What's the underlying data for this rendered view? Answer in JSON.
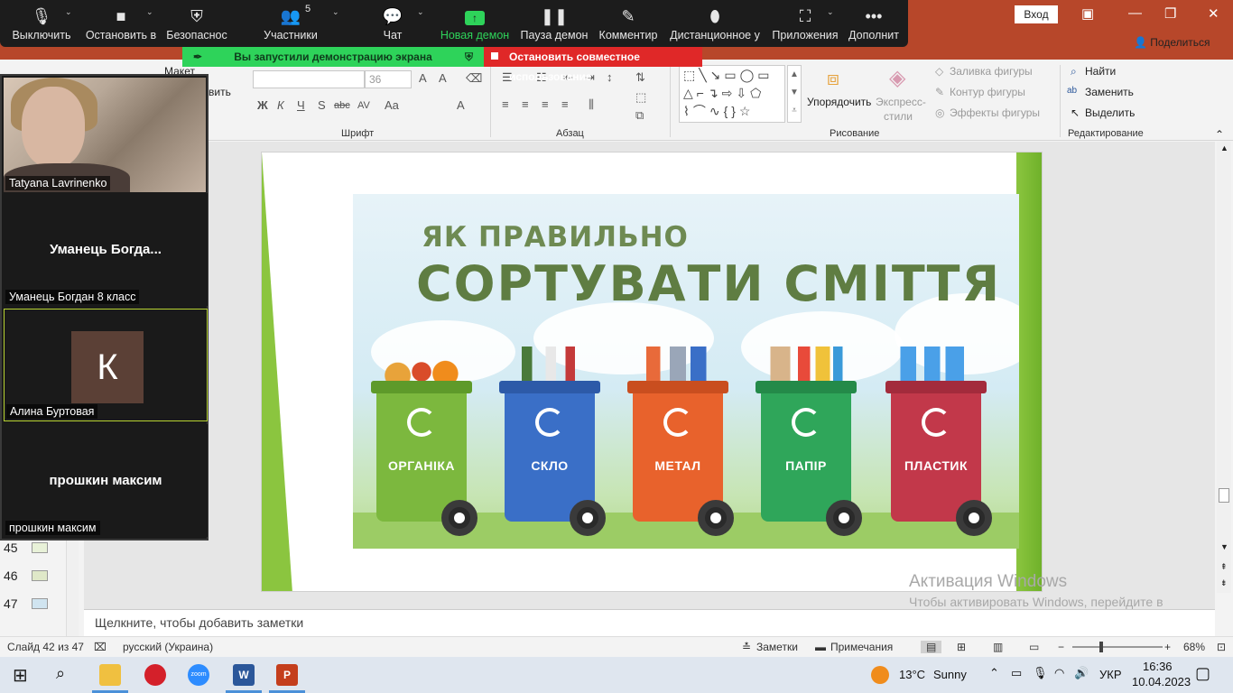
{
  "zoom_toolbar": {
    "items": [
      {
        "label": "Выключить",
        "icon": "microphone-icon"
      },
      {
        "label": "Остановить в",
        "icon": "video-camera-icon"
      },
      {
        "label": "Безопаснос",
        "icon": "shield-icon"
      },
      {
        "label": "Участники",
        "icon": "participants-icon"
      },
      {
        "label": "Чат",
        "icon": "chat-icon"
      },
      {
        "label": "Новая демон",
        "icon": "share-screen-icon"
      },
      {
        "label": "Пауза демон",
        "icon": "pause-icon"
      },
      {
        "label": "Комментир",
        "icon": "annotate-pen-icon"
      },
      {
        "label": "Дистанционное у",
        "icon": "remote-control-icon"
      },
      {
        "label": "Приложения",
        "icon": "apps-icon"
      },
      {
        "label": "Дополнит",
        "icon": "more-icon"
      }
    ],
    "participant_count": "5",
    "share_banner": "Вы запустили демонстрацию экрана",
    "stop_banner": "Остановить совместное использование",
    "accent_green": "#2ed35a",
    "accent_red": "#e02828"
  },
  "participants": [
    {
      "name": "Tatyana Lavrinenko",
      "display": ""
    },
    {
      "name": "Уманець Богдан 8 класс",
      "display": "Уманець  Богда..."
    },
    {
      "name": "Алина Буртовая",
      "display": "",
      "initial": "К"
    },
    {
      "name": "прошкин максим",
      "display": "прошкин максим"
    }
  ],
  "ppt": {
    "signin": "Вход",
    "share": "Поделиться",
    "ribbon": {
      "font_size": "36",
      "groups": [
        "Шрифт",
        "Абзац",
        "Рисование",
        "Редактирование"
      ],
      "partial_left_1": "Макет",
      "partial_left_2": "вить",
      "arrange": "Упорядочить",
      "quick_styles_1": "Экспресс-",
      "quick_styles_2": "стили",
      "shape_fill": "Заливка фигуры",
      "shape_outline": "Контур фигуры",
      "shape_effects": "Эффекты фигуры",
      "find": "Найти",
      "replace": "Заменить",
      "select": "Выделить",
      "format_letters": [
        "Ж",
        "К",
        "Ч",
        "S",
        "abc",
        "AV",
        "Aa",
        "A"
      ]
    },
    "thumbs": [
      {
        "num": "45"
      },
      {
        "num": "46"
      },
      {
        "num": "47"
      }
    ],
    "slide": {
      "subtitle": "ЯК ПРАВИЛЬНО",
      "title": "СОРТУВАТИ СМІТТЯ",
      "bins": [
        {
          "label": "ОРГАНІКА",
          "color": "#7cb83e",
          "lid": "#5e9a2a"
        },
        {
          "label": "СКЛО",
          "color": "#3a6fc7",
          "lid": "#2d5aa8"
        },
        {
          "label": "МЕТАЛ",
          "color": "#e8622c",
          "lid": "#c94e1f"
        },
        {
          "label": "ПАПІР",
          "color": "#2fa65a",
          "lid": "#248a49"
        },
        {
          "label": "ПЛАСТИК",
          "color": "#c2384a",
          "lid": "#a32b3c"
        }
      ]
    },
    "activation": {
      "title": "Активация Windows",
      "text": "Чтобы активировать Windows, перейдите в раздел \"Параметры\"."
    },
    "notes_placeholder": "Щелкните, чтобы добавить заметки",
    "status": {
      "slide": "Слайд 42 из 47",
      "language": "русский (Украина)",
      "notes": "Заметки",
      "comments": "Примечания",
      "zoom": "68%"
    }
  },
  "taskbar": {
    "weather_temp": "13°C",
    "weather_text": "Sunny",
    "lang": "УКР",
    "time": "16:36",
    "date": "10.04.2023",
    "apps": [
      "windows-start-icon",
      "search-icon",
      "file-explorer-icon",
      "opera-icon",
      "zoom-icon",
      "word-icon",
      "powerpoint-icon"
    ]
  }
}
